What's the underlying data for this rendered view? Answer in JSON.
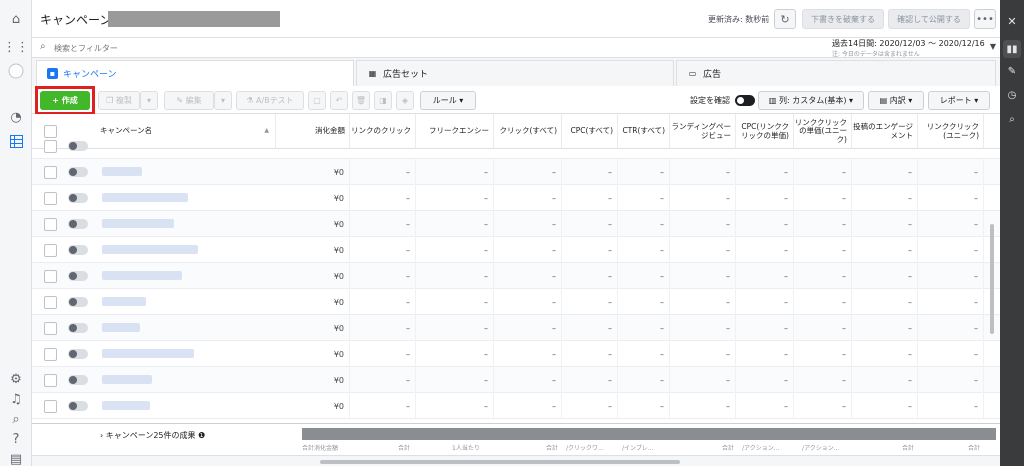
{
  "header": {
    "title": "キャンペーン",
    "updated": "更新済み: 数秒前",
    "discard_label": "下書きを破棄する",
    "publish_label": "確認して公開する",
    "more_label": "•••"
  },
  "search": {
    "placeholder": "検索とフィルター",
    "date_range": "過去14日間: 2020/12/03 〜 2020/12/16",
    "date_note": "注: 今日のデータは含まれません"
  },
  "tabs": [
    {
      "label": "キャンペーン",
      "active": true
    },
    {
      "label": "広告セット",
      "active": false
    },
    {
      "label": "広告",
      "active": false
    }
  ],
  "toolbar": {
    "create_label": "+ 作成",
    "duplicate_label": "複製",
    "edit_label": "編集",
    "abtest_label": "A/Bテスト",
    "rules_label": "ルール ▾",
    "settings_label": "設定を確認",
    "columns_label": "列: カスタム(基本) ▾",
    "breakdown_label": "内訳 ▾",
    "report_label": "レポート ▾"
  },
  "table": {
    "columns": [
      "キャンペーン名",
      "消化金額",
      "リンクのクリック",
      "フリークエンシー",
      "クリック(すべて)",
      "CPC(すべて)",
      "CTR(すべて)",
      "ランディングページビュー",
      "CPC(リンククリックの単価)",
      "リンククリックの単価(ユニーク)",
      "投稿のエンゲージメント",
      "リンククリック(ユニーク)"
    ],
    "rows": [
      {
        "spend": "¥0"
      },
      {
        "spend": "¥0"
      },
      {
        "spend": "¥0"
      },
      {
        "spend": "¥0"
      },
      {
        "spend": "¥0"
      },
      {
        "spend": "¥0"
      },
      {
        "spend": "¥0"
      },
      {
        "spend": "¥0"
      },
      {
        "spend": "¥0"
      },
      {
        "spend": "¥0"
      }
    ],
    "dash": "–"
  },
  "footer": {
    "summary_label": "›  キャンペーン25件の成果 ❶",
    "sub_spend": "合計消化金額",
    "sub_total": "合計",
    "sub_per_person": "1人当たり",
    "sub_per_click": "/クリックワ...",
    "sub_per_imp": "/インプレ...",
    "sub_per_action": "/アクション..."
  }
}
